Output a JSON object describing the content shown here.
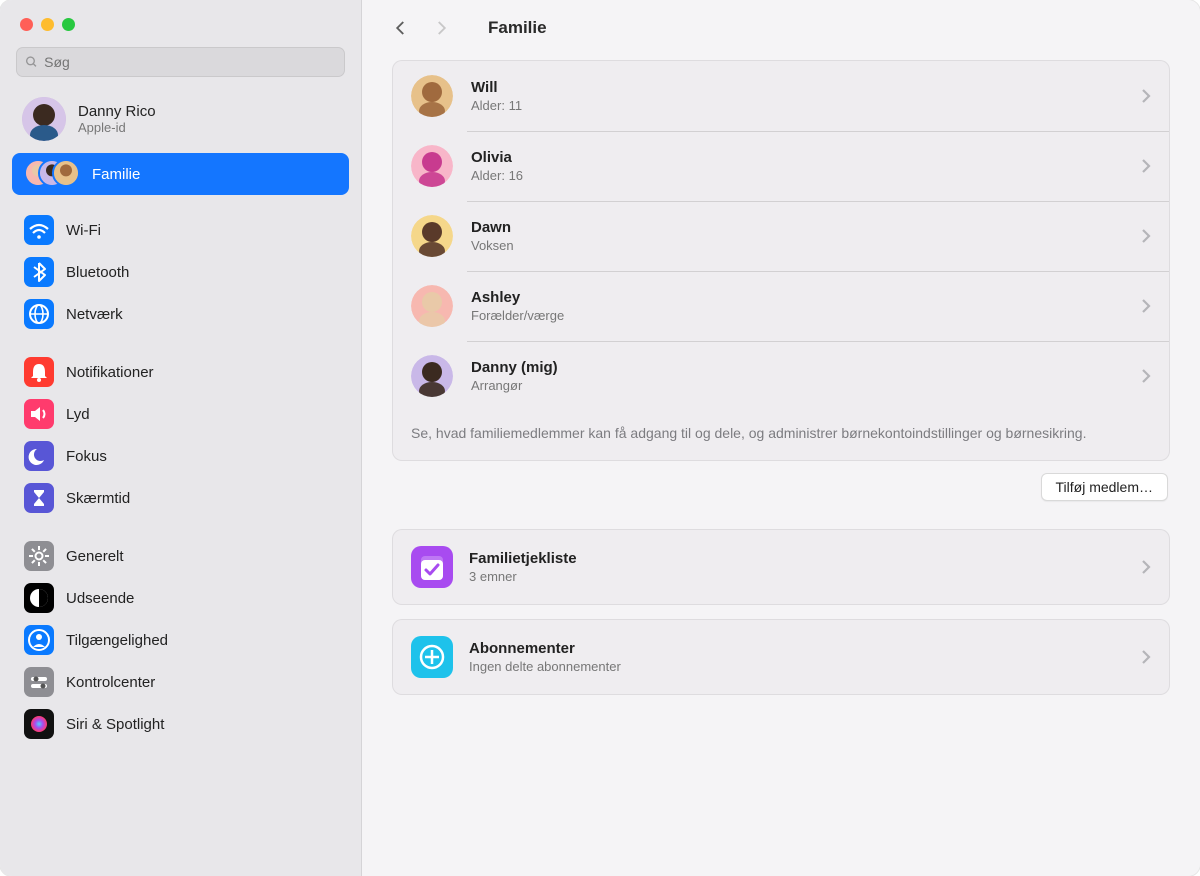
{
  "window": {
    "title": "Familie"
  },
  "search": {
    "placeholder": "Søg"
  },
  "account": {
    "name": "Danny Rico",
    "sub": "Apple-id"
  },
  "sidebar": {
    "family_label": "Familie",
    "groups": [
      [
        {
          "key": "wifi",
          "label": "Wi-Fi",
          "color": "#0a7aff"
        },
        {
          "key": "bluetooth",
          "label": "Bluetooth",
          "color": "#0a7aff"
        },
        {
          "key": "network",
          "label": "Netværk",
          "color": "#0a7aff"
        }
      ],
      [
        {
          "key": "notifications",
          "label": "Notifikationer",
          "color": "#ff3b30"
        },
        {
          "key": "sound",
          "label": "Lyd",
          "color": "#ff3b6d"
        },
        {
          "key": "focus",
          "label": "Fokus",
          "color": "#5856d6"
        },
        {
          "key": "screentime",
          "label": "Skærmtid",
          "color": "#5856d6"
        }
      ],
      [
        {
          "key": "general",
          "label": "Generelt",
          "color": "#8e8e93"
        },
        {
          "key": "appearance",
          "label": "Udseende",
          "color": "#000000"
        },
        {
          "key": "accessibility",
          "label": "Tilgængelighed",
          "color": "#0a7aff"
        },
        {
          "key": "control-center",
          "label": "Kontrolcenter",
          "color": "#8e8e93"
        },
        {
          "key": "siri",
          "label": "Siri & Spotlight",
          "color": "#222"
        }
      ]
    ]
  },
  "members": [
    {
      "name": "Will",
      "sub": "Alder: 11",
      "bg": "#e7c18a",
      "face": "#a06a3e"
    },
    {
      "name": "Olivia",
      "sub": "Alder: 16",
      "bg": "#f8b6c9",
      "face": "#c83b8f"
    },
    {
      "name": "Dawn",
      "sub": "Voksen",
      "bg": "#f5d78a",
      "face": "#5a3a2a"
    },
    {
      "name": "Ashley",
      "sub": "Forælder/værge",
      "bg": "#f7b8b0",
      "face": "#e9c9a8"
    },
    {
      "name": "Danny (mig)",
      "sub": "Arrangør",
      "bg": "#c9b8e8",
      "face": "#3b2a20"
    }
  ],
  "members_footer": "Se, hvad familiemedlemmer kan få adgang til og dele, og administrer børnekontoindstillinger og børnesikring.",
  "add_member_label": "Tilføj medlem…",
  "features": [
    {
      "key": "checklist",
      "title": "Familietjekliste",
      "sub": "3 emner",
      "color": "#a84bf0"
    },
    {
      "key": "subscriptions",
      "title": "Abonnementer",
      "sub": "Ingen delte abonnementer",
      "color": "#1ec2eb"
    }
  ],
  "icons": {
    "wifi": "wifi",
    "bluetooth": "bluetooth",
    "network": "globe",
    "notifications": "bell",
    "sound": "speaker",
    "focus": "moon",
    "screentime": "hourglass",
    "general": "gear",
    "appearance": "contrast",
    "accessibility": "person",
    "control-center": "sliders",
    "siri": "siri"
  }
}
